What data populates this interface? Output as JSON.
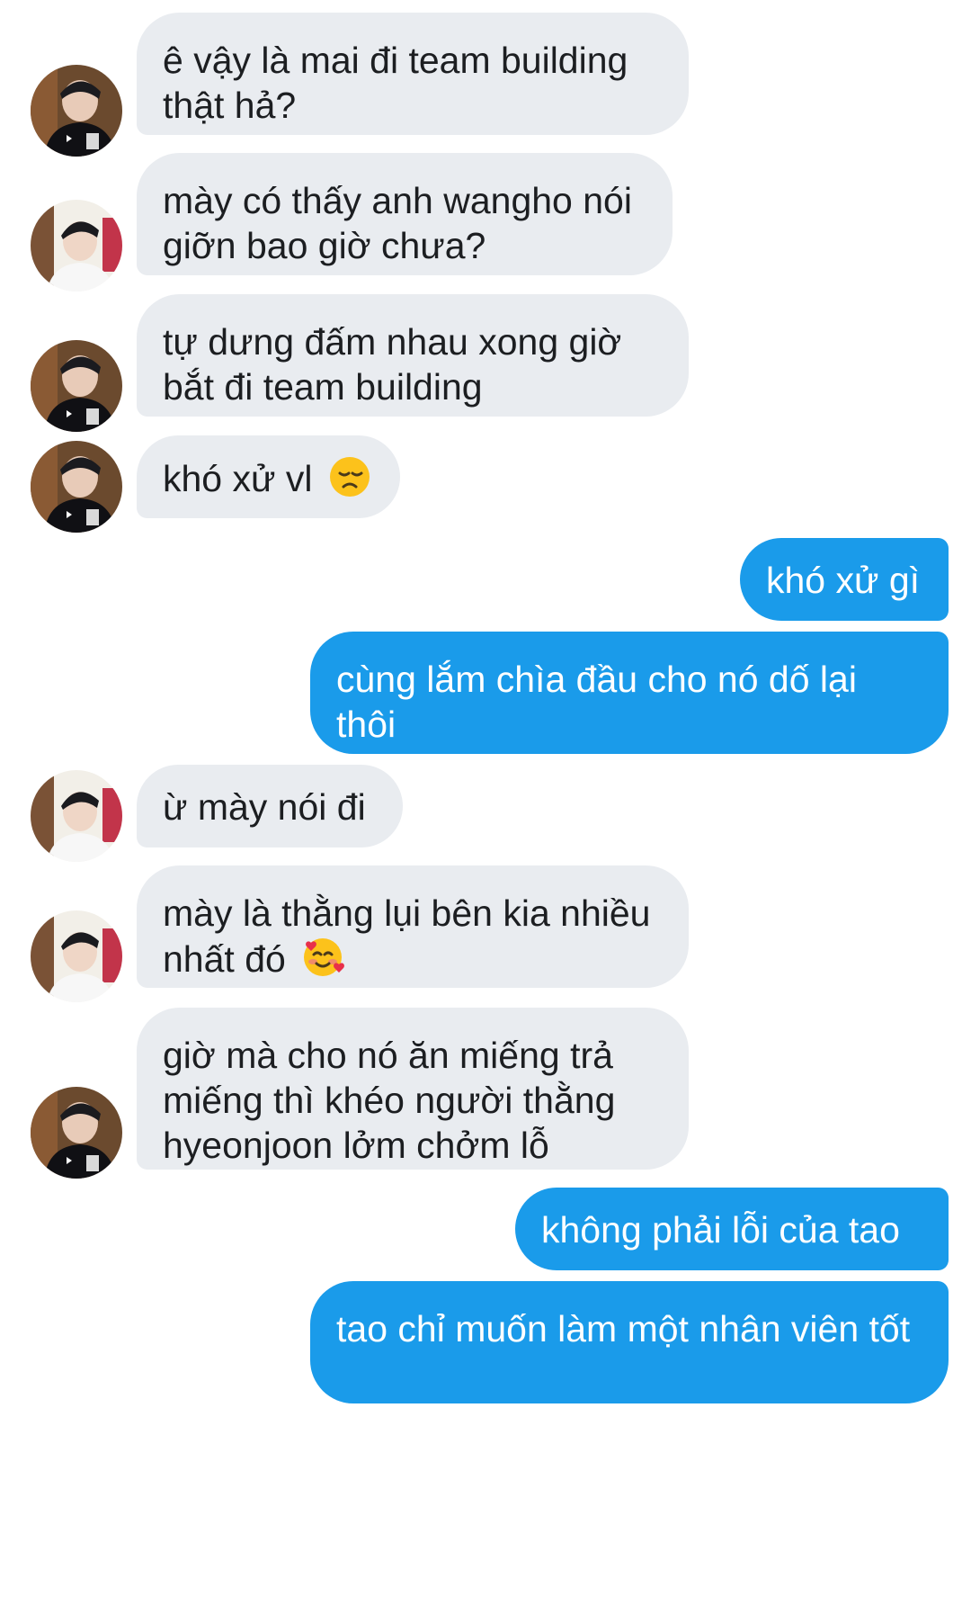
{
  "conversation": {
    "messages": [
      {
        "from": "other",
        "avatar": "avatar-a",
        "text": "ê vậy là mai đi team building thật hả?"
      },
      {
        "from": "other",
        "avatar": "avatar-b",
        "text": "mày có thấy anh wangho nói giỡn bao giờ chưa?"
      },
      {
        "from": "other",
        "avatar": "avatar-a",
        "text": "tự dưng đấm nhau xong giờ bắt đi team building"
      },
      {
        "from": "other",
        "avatar": "avatar-a",
        "text": "khó xử vl",
        "emoji": "disappointed-face-emoji"
      },
      {
        "from": "me",
        "text": "khó xử gì"
      },
      {
        "from": "me",
        "text": "cùng lắm chìa đầu cho nó dố lại thôi"
      },
      {
        "from": "other",
        "avatar": "avatar-b",
        "text": "ừ mày nói đi"
      },
      {
        "from": "other",
        "avatar": "avatar-b",
        "text": "mày là thằng lụi bên kia nhiều nhất đó",
        "emoji": "smiling-face-with-hearts-emoji"
      },
      {
        "from": "other",
        "avatar": "avatar-a",
        "text": "giờ mà cho nó ăn miếng trả miếng thì khéo người thằng hyeonjoon lởm chởm lỗ"
      },
      {
        "from": "me",
        "text": "không phải lỗi của tao"
      },
      {
        "from": "me",
        "text": "tao chỉ muốn làm một nhân viên tốt"
      }
    ]
  },
  "colors": {
    "incoming_bubble": "#e9ecf0",
    "outgoing_bubble": "#1a9bea",
    "incoming_text": "#1c1e21",
    "outgoing_text": "#ffffff",
    "background": "#ffffff"
  }
}
